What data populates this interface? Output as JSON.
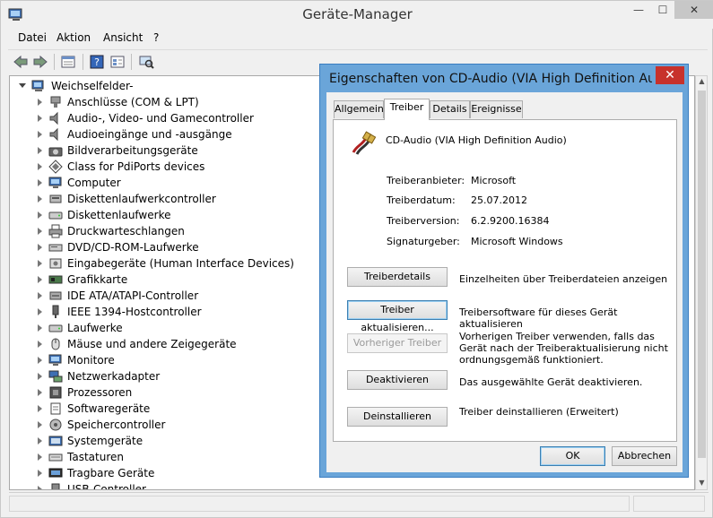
{
  "window": {
    "title": "Geräte-Manager",
    "minimize_glyph": "—",
    "maximize_glyph": "☐",
    "close_glyph": "✕"
  },
  "menu": [
    "Datei",
    "Aktion",
    "Ansicht",
    "?"
  ],
  "toolbar_icons": [
    "back-icon",
    "forward-icon",
    "properties-icon",
    "help-icon",
    "details-icon",
    "scan-hardware-icon"
  ],
  "tree": {
    "root": "Weichselfelder-",
    "items": [
      {
        "label": "Anschlüsse (COM & LPT)",
        "icon": "port-icon"
      },
      {
        "label": "Audio-, Video- und Gamecontroller",
        "icon": "speaker-icon"
      },
      {
        "label": "Audioeingänge und -ausgänge",
        "icon": "speaker-icon"
      },
      {
        "label": "Bildverarbeitungsgeräte",
        "icon": "camera-icon"
      },
      {
        "label": "Class for PdiPorts devices",
        "icon": "diamond-icon"
      },
      {
        "label": "Computer",
        "icon": "monitor-icon"
      },
      {
        "label": "Diskettenlaufwerkcontroller",
        "icon": "disk-controller-icon"
      },
      {
        "label": "Diskettenlaufwerke",
        "icon": "drive-icon"
      },
      {
        "label": "Druckwarteschlangen",
        "icon": "printer-icon"
      },
      {
        "label": "DVD/CD-ROM-Laufwerke",
        "icon": "optical-drive-icon"
      },
      {
        "label": "Eingabegeräte (Human Interface Devices)",
        "icon": "hid-icon"
      },
      {
        "label": "Grafikkarte",
        "icon": "display-adapter-icon"
      },
      {
        "label": "IDE ATA/ATAPI-Controller",
        "icon": "ide-icon"
      },
      {
        "label": "IEEE 1394-Hostcontroller",
        "icon": "firewire-icon"
      },
      {
        "label": "Laufwerke",
        "icon": "drive-icon"
      },
      {
        "label": "Mäuse und andere Zeigegeräte",
        "icon": "mouse-icon"
      },
      {
        "label": "Monitore",
        "icon": "monitor-icon"
      },
      {
        "label": "Netzwerkadapter",
        "icon": "network-icon"
      },
      {
        "label": "Prozessoren",
        "icon": "cpu-icon"
      },
      {
        "label": "Softwaregeräte",
        "icon": "software-icon"
      },
      {
        "label": "Speichercontroller",
        "icon": "storage-icon"
      },
      {
        "label": "Systemgeräte",
        "icon": "system-icon"
      },
      {
        "label": "Tastaturen",
        "icon": "keyboard-icon"
      },
      {
        "label": "Tragbare Geräte",
        "icon": "portable-icon"
      },
      {
        "label": "USB-Controller",
        "icon": "usb-icon"
      }
    ]
  },
  "dialog": {
    "title": "Eigenschaften von CD-Audio (VIA High Definition Audio)",
    "close_glyph": "✕",
    "tabs": [
      "Allgemein",
      "Treiber",
      "Details",
      "Ereignisse"
    ],
    "active_tab": "Treiber",
    "device_name": "CD-Audio (VIA High Definition Audio)",
    "properties": [
      {
        "label": "Treiberanbieter:",
        "value": "Microsoft"
      },
      {
        "label": "Treiberdatum:",
        "value": "25.07.2012"
      },
      {
        "label": "Treiberversion:",
        "value": "6.2.9200.16384"
      },
      {
        "label": "Signaturgeber:",
        "value": "Microsoft Windows"
      }
    ],
    "actions": [
      {
        "label": "Treiberdetails",
        "desc": "Einzelheiten über Treiberdateien anzeigen",
        "enabled": true
      },
      {
        "label": "Treiber aktualisieren...",
        "desc": "Treibersoftware für dieses Gerät aktualisieren",
        "enabled": true
      },
      {
        "label": "Vorheriger Treiber",
        "desc": "Vorherigen Treiber verwenden, falls das Gerät nach der Treiberaktualisierung nicht ordnungsgemäß funktioniert.",
        "enabled": false
      },
      {
        "label": "Deaktivieren",
        "desc": "Das ausgewählte Gerät deaktivieren.",
        "enabled": true
      },
      {
        "label": "Deinstallieren",
        "desc": "Treiber deinstallieren (Erweitert)",
        "enabled": true
      }
    ],
    "ok_label": "OK",
    "cancel_label": "Abbrechen"
  }
}
